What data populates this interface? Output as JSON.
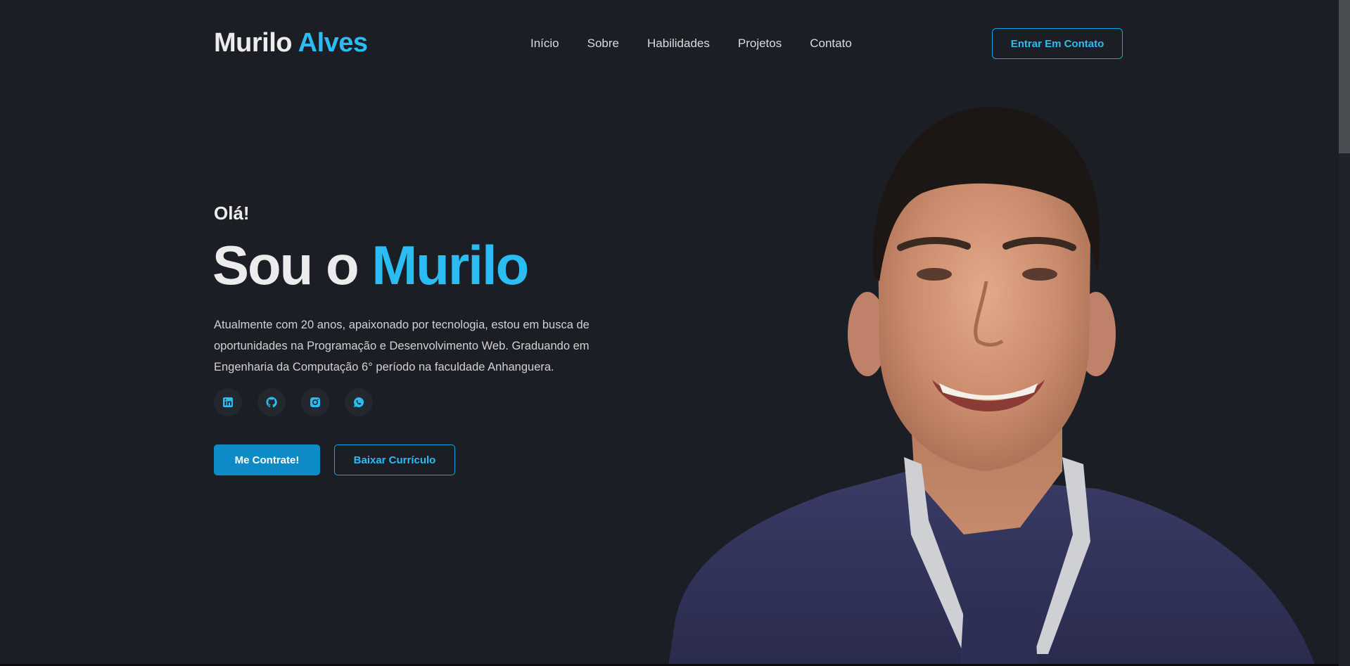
{
  "header": {
    "logo_first": "Murilo",
    "logo_second": "Alves",
    "nav": [
      "Início",
      "Sobre",
      "Habilidades",
      "Projetos",
      "Contato"
    ],
    "cta_label": "Entrar Em Contato"
  },
  "hero": {
    "greeting": "Olá!",
    "headline_prefix": "Sou o",
    "headline_name": "Murilo",
    "description": "Atualmente com 20 anos, apaixonado por tecnologia, estou em busca de oportunidades na Programação e Desenvolvimento Web. Graduando em Engenharia da Computação 6° período na faculdade Anhanguera.",
    "socials": [
      "linkedin-icon",
      "github-icon",
      "instagram-icon",
      "whatsapp-icon"
    ],
    "primary_button": "Me Contrate!",
    "secondary_button": "Baixar Currículo"
  },
  "colors": {
    "background": "#1b1e24",
    "accent": "#2bbcf3",
    "primary_button": "#0e8ac7",
    "social_bg": "#23272e"
  }
}
